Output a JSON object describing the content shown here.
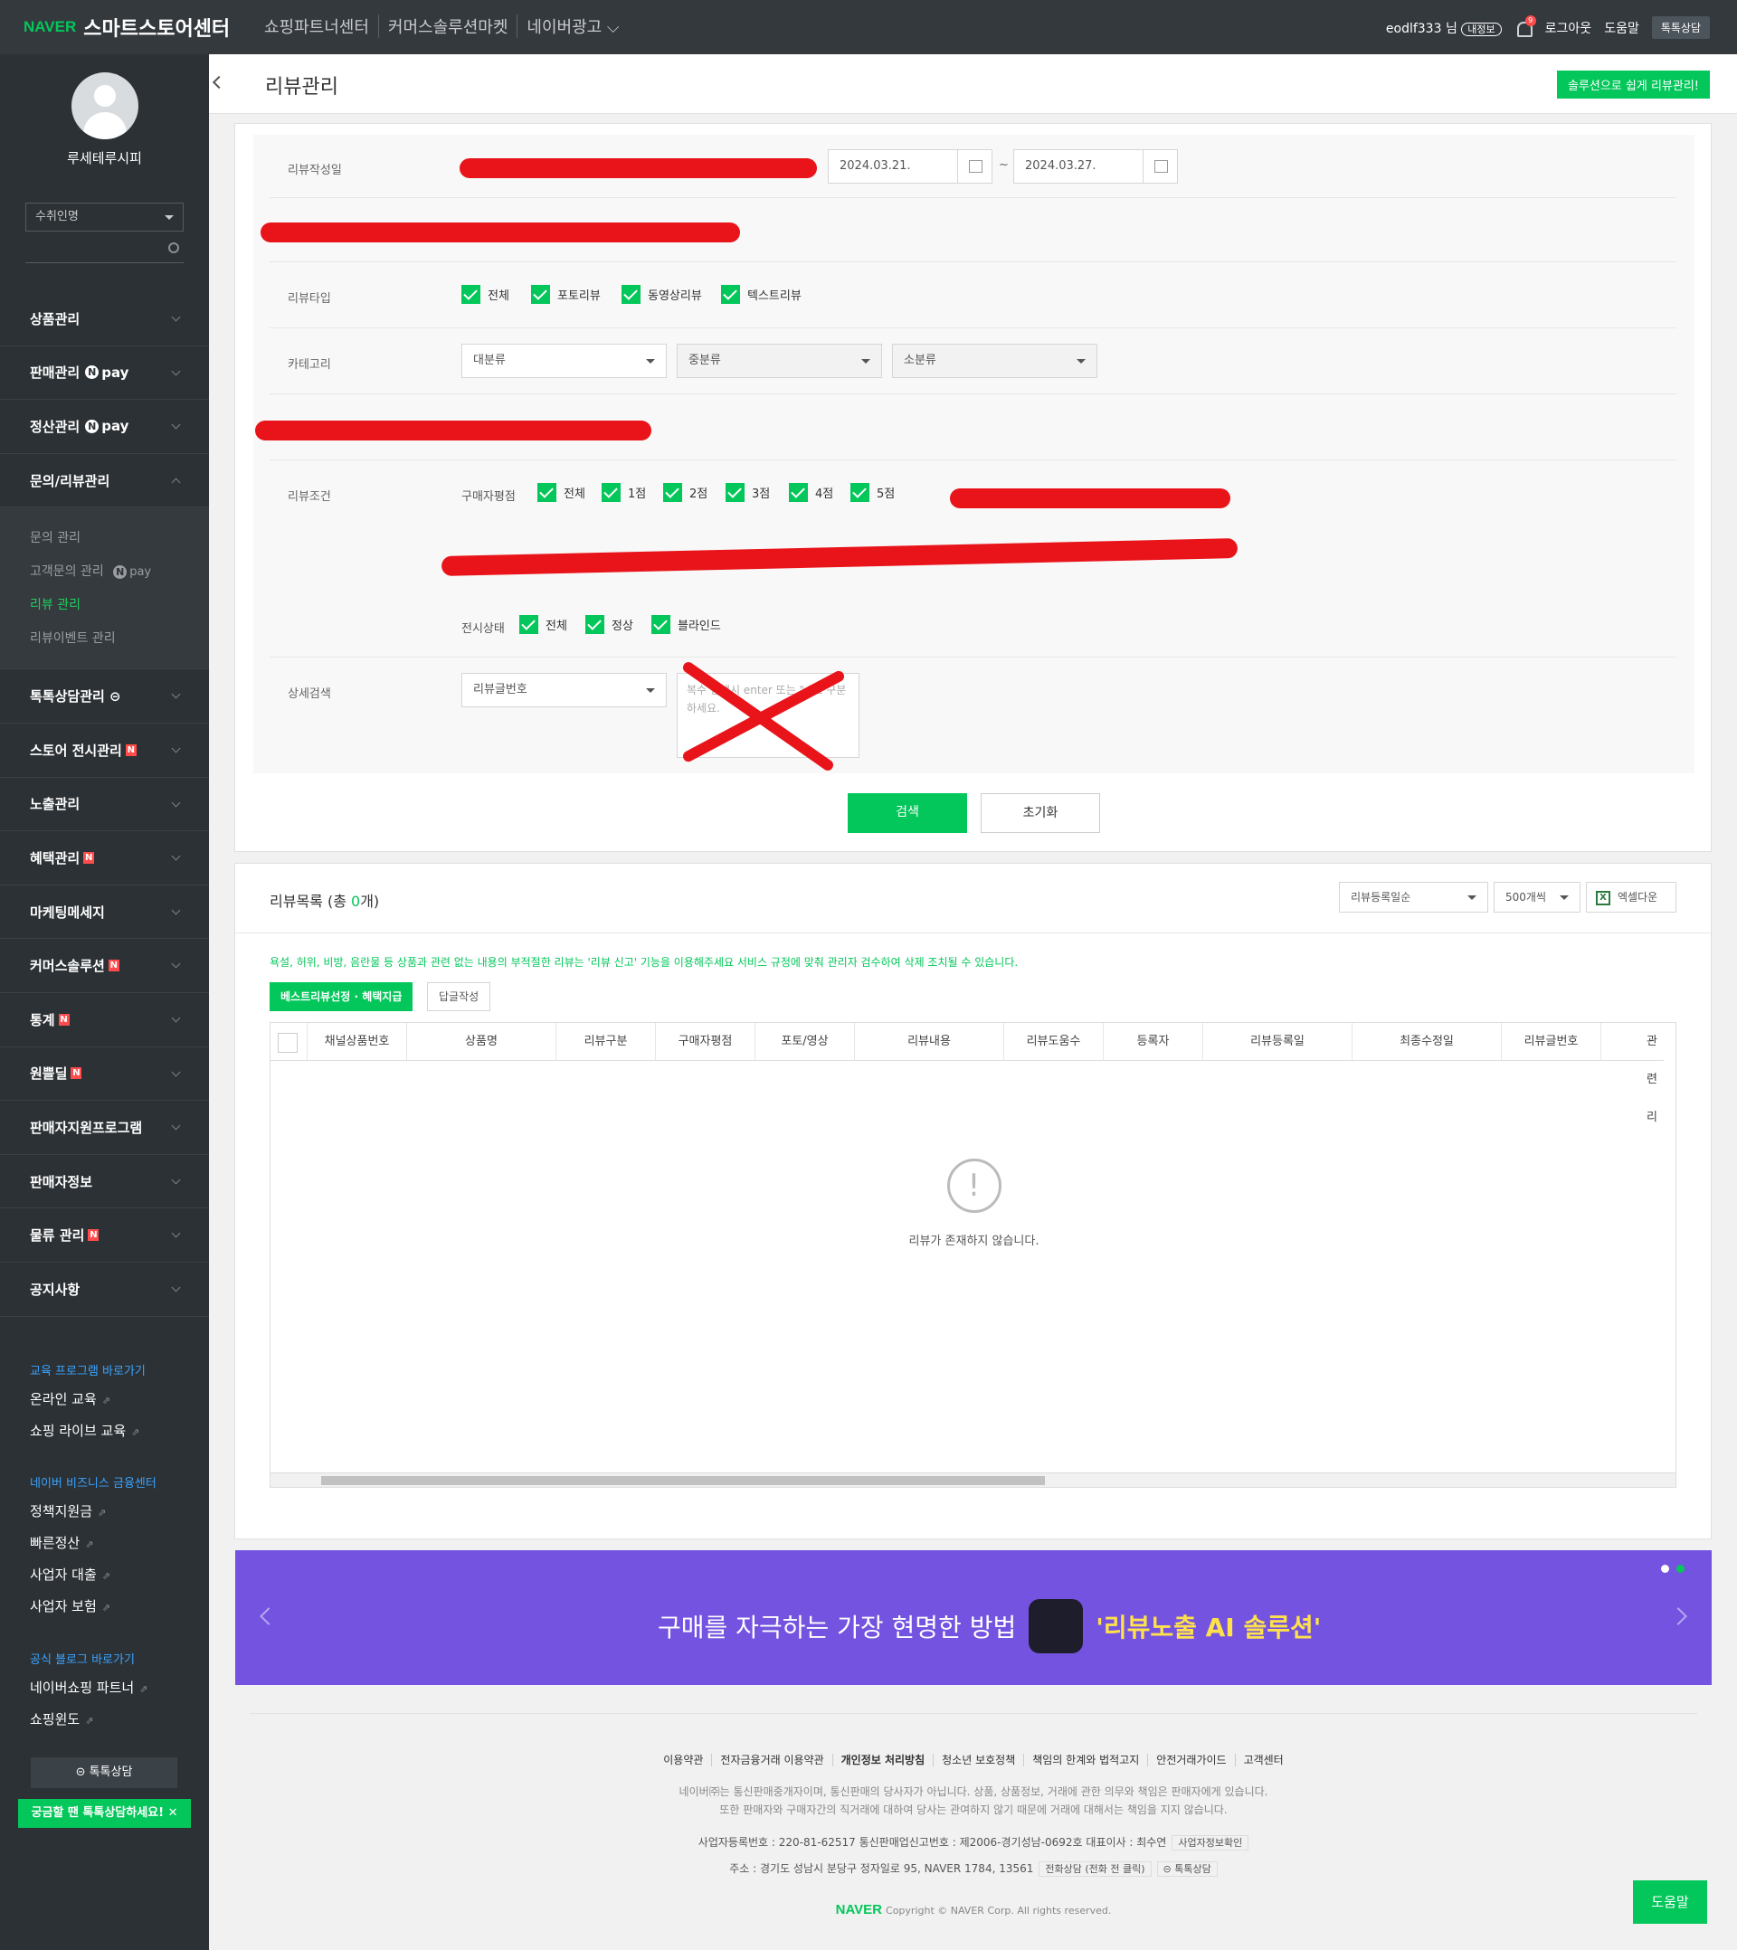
{
  "topbar": {
    "naver": "NAVER",
    "brand": "스마트스토어센터",
    "nav": [
      "쇼핑파트너센터",
      "커머스솔루션마켓",
      "네이버광고 ⌵"
    ],
    "user": "eodlf333 님",
    "myinfo": "내정보",
    "bell_count": "9",
    "logout": "로그아웃",
    "help": "도움말",
    "talk": "톡톡상담"
  },
  "sidebar": {
    "profile_name": "루세테루시피",
    "store_select": "수취인명",
    "menu": [
      {
        "label": "상품관리"
      },
      {
        "label": "판매관리",
        "npay": "pay"
      },
      {
        "label": "정산관리",
        "npay": "pay"
      },
      {
        "label": "문의/리뷰관리"
      }
    ],
    "sub": [
      "문의 관리",
      "고객문의 관리",
      "리뷰 관리",
      "리뷰이벤트 관리"
    ],
    "sub_npay": "pay",
    "menu2": [
      {
        "label": "톡톡상담관리 ⊝"
      },
      {
        "label": "스토어 전시관리",
        "n": "N"
      },
      {
        "label": "노출관리"
      },
      {
        "label": "혜택관리",
        "n": "N"
      },
      {
        "label": "마케팅메세지"
      },
      {
        "label": "커머스솔루션",
        "n": "N"
      },
      {
        "label": "통계",
        "n": "N"
      },
      {
        "label": "원쁠딜",
        "n": "N"
      },
      {
        "label": "판매자지원프로그램"
      },
      {
        "label": "판매자정보"
      },
      {
        "label": "물류 관리",
        "n": "N"
      },
      {
        "label": "공지사항"
      }
    ],
    "edu_head": "교육 프로그램 바로가기",
    "edu": [
      "온라인 교육",
      "쇼핑 라이브 교육"
    ],
    "fin_head": "네이버 비즈니스 금융센터",
    "fin": [
      "정책지원금",
      "빠른정산",
      "사업자 대출",
      "사업자 보험"
    ],
    "blog_head": "공식 블로그 바로가기",
    "blog": [
      "네이버쇼핑 파트너",
      "쇼핑윈도"
    ],
    "talk_btn": "⊝ 톡톡상담",
    "tip": "궁금할 땐 톡톡상담하세요! ✕"
  },
  "header": {
    "title": "리뷰관리",
    "solution_btn": "솔루션으로 쉽게 리뷰관리!"
  },
  "search": {
    "date_label": "리뷰작성일",
    "date_from": "2024.03.21.",
    "date_to": "2024.03.27.",
    "date_sep": "~",
    "type_label": "리뷰타입",
    "types": [
      "전체",
      "포토리뷰",
      "동영상리뷰",
      "텍스트리뷰"
    ],
    "cat_label": "카테고리",
    "cat1": "대분류",
    "cat2": "중분류",
    "cat3": "소분류",
    "cond_label": "리뷰조건",
    "rating_label": "구매자평점",
    "ratings": [
      "전체",
      "1점",
      "2점",
      "3점",
      "4점",
      "5점"
    ],
    "display_label": "전시상태",
    "displays": [
      "전체",
      "정상",
      "블라인드"
    ],
    "detail_label": "상세검색",
    "detail_select": "리뷰글번호",
    "detail_placeholder": "복수 검색시 enter 또는 \",\"로 구분하세요.",
    "search_btn": "검색",
    "reset_btn": "초기화"
  },
  "list": {
    "title": "리뷰목록 (총 ",
    "count": "0",
    "title_end": "개)",
    "sort": "리뷰등록일순",
    "per_page": "500개씩",
    "excel": "엑셀다운",
    "warning": "욕설, 허위, 비방, 음란물 등 상품과 관련 없는 내용의 부적절한 리뷰는 '리뷰 신고' 기능을 이용해주세요 서비스 규정에 맞춰 관리자 검수하여 삭제 조치될 수 있습니다.",
    "best_btn": "베스트리뷰선정 · 혜택지급",
    "reply_btn": "답글작성",
    "columns": [
      "채널상품번호",
      "상품명",
      "리뷰구분",
      "구매자평점",
      "포토/영상",
      "리뷰내용",
      "리뷰도움수",
      "등록자",
      "리뷰등록일",
      "최종수정일",
      "리뷰글번호",
      "관련리"
    ],
    "empty": "리뷰가 존재하지 않습니다."
  },
  "banner": {
    "text": "구매를 자극하는 가장 현명한 방법",
    "highlight": "'리뷰노출 AI 솔루션'"
  },
  "footer": {
    "links": [
      "이용약관",
      "전자금융거래 이용약관",
      "개인정보 처리방침",
      "청소년 보호정책",
      "책임의 한계와 법적고지",
      "안전거래가이드",
      "고객센터"
    ],
    "desc1": "네이버㈜는 통신판매중개자이며, 통신판매의 당사자가 아닙니다. 상품, 상품정보, 거래에 관한 의무와 책임은 판매자에게 있습니다.",
    "desc2": "또한 판매자와 구매자간의 직거래에 대하여 당사는 관여하지 않기 때문에 거래에 대해서는 책임을 지지 않습니다.",
    "info1": "사업자등록번호 : 220-81-62517   통신판매업신고번호 : 제2006-경기성남-0692호   대표이사 : 최수연",
    "biz_check": "사업자정보확인",
    "info2": "주소 : 경기도 성남시 분당구 정자일로 95, NAVER 1784, 13561",
    "phone": "전화상담 (전화 전 클릭)",
    "talk": "⊝ 톡톡상담",
    "copy_brand": "NAVER",
    "copy": "Copyright © NAVER Corp. All rights reserved."
  },
  "help_btn": "도움말"
}
